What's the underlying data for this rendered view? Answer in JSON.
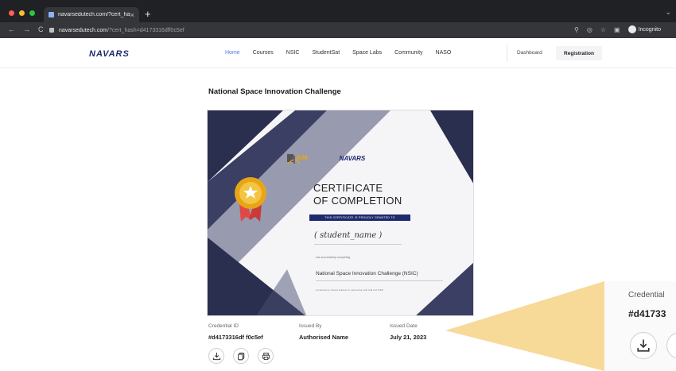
{
  "browser": {
    "tab_title": "navarsedutech.com/?cert_has",
    "close_glyph": "×",
    "new_tab_glyph": "+",
    "url_host": "navarsedutech.com",
    "url_path": "/?cert_hash=d4173316dff0c5ef",
    "incognito_label": "Incognito",
    "nav_back": "←",
    "nav_forward": "→",
    "nav_reload": "C"
  },
  "header": {
    "logo": "NAVARS",
    "menu": [
      "Home",
      "Courses",
      "NSIC",
      "StudentSat",
      "Space Labs",
      "Community",
      "NASO"
    ],
    "dashboard": "Dashboard",
    "registration": "Registration"
  },
  "page": {
    "title": "National Space Innovation Challenge"
  },
  "certificate": {
    "aim_logo": "AIM",
    "brand_logo": "NAVARS",
    "heading_line1": "CERTIFICATE",
    "heading_line2": "OF COMPLETION",
    "banner": "THIS CERTIFICATE IS PROUDLY GRANTED TO",
    "recipient": "( student_name )",
    "sub": "has successfully completing",
    "program": "National Space Innovation Challenge (NSIC)",
    "small": "conducted by Navars Edutech in partnership with AIM and ISRO"
  },
  "details": {
    "credential_label": "Credential ID",
    "credential_value": "#d4173316df f0c5ef",
    "issued_by_label": "Issued By",
    "issued_by_value": "Authorised Name",
    "issued_date_label": "Issued Date",
    "issued_date_value": "July 21, 2023"
  },
  "zoom": {
    "label": "Credential",
    "value": "#d41733"
  },
  "colors": {
    "accent": "#4a7fd8",
    "navy": "#2a2e4f",
    "callout": "#f7d792",
    "gold": "#e8a517",
    "ribbon": "#e04848"
  }
}
